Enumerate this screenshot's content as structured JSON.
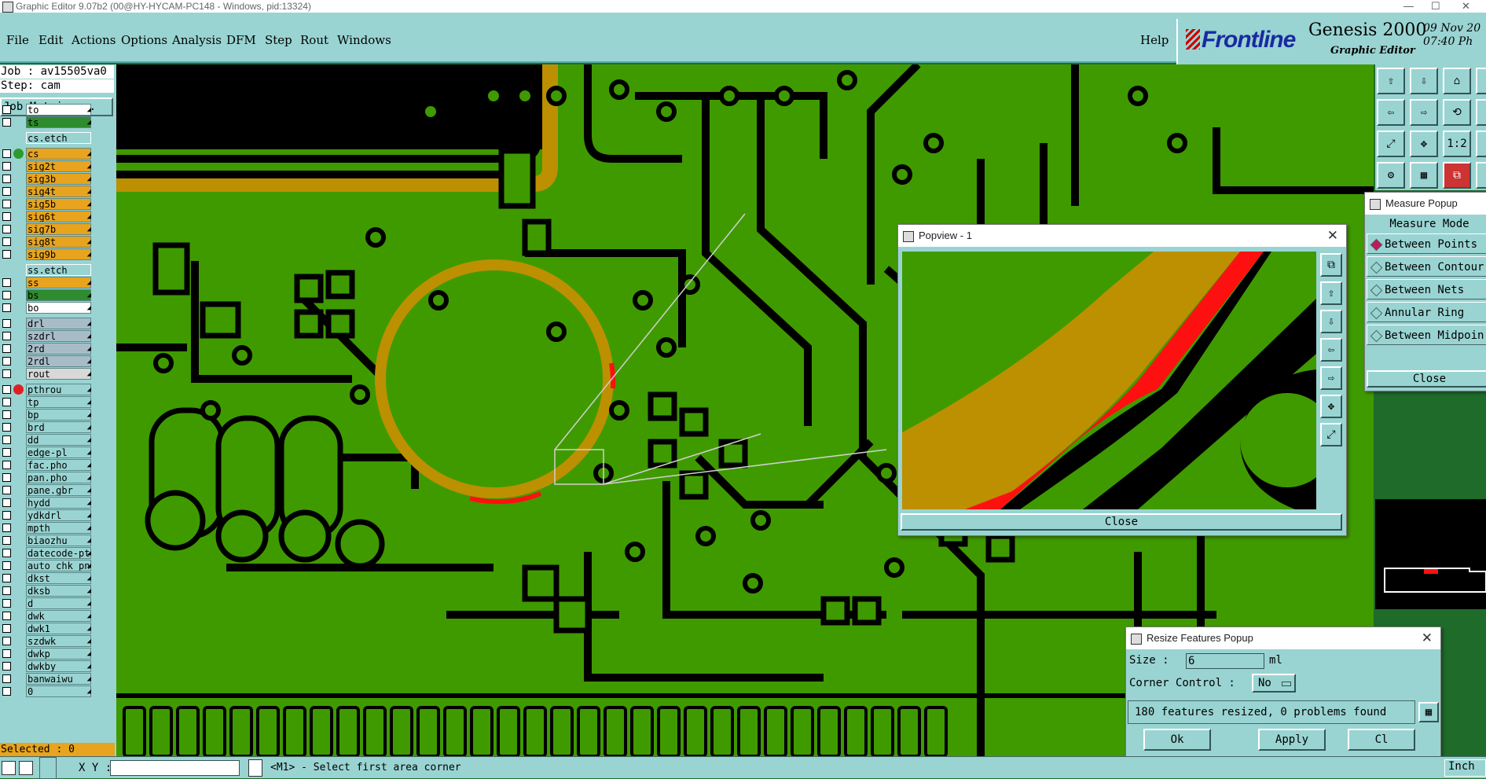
{
  "titlebar": {
    "title": "Graphic Editor 9.07b2 (00@HY-HYCAM-PC148 - Windows, pid:13324)",
    "minimize": "—",
    "maximize": "☐",
    "close": "✕"
  },
  "menu": {
    "items": [
      "File",
      "Edit",
      "Actions",
      "Options",
      "Analysis",
      "DFM",
      "Step",
      "Rout",
      "Windows"
    ],
    "help": "Help"
  },
  "brand": {
    "logo": "Frontline",
    "product": "Genesis 2000",
    "subtitle": "Graphic Editor",
    "date": "09 Nov 20",
    "time": "07:40 Ph"
  },
  "job": {
    "job_line": "Job : av15505va0",
    "step_line": "Step: cam",
    "matrix_button": "Job Matrix ..."
  },
  "layers": [
    {
      "name": "to",
      "color": "#ffffff",
      "ind": ""
    },
    {
      "name": "ts",
      "color": "#2e8b2e",
      "ind": ""
    },
    {
      "name": "cs.etch",
      "color": "#99d4d2",
      "ind": "",
      "header": true
    },
    {
      "name": "cs",
      "color": "#e8a41e",
      "ind": "#2e9b2e"
    },
    {
      "name": "sig2t",
      "color": "#e8a41e",
      "ind": ""
    },
    {
      "name": "sig3b",
      "color": "#e8a41e",
      "ind": ""
    },
    {
      "name": "sig4t",
      "color": "#e8a41e",
      "ind": ""
    },
    {
      "name": "sig5b",
      "color": "#e8a41e",
      "ind": ""
    },
    {
      "name": "sig6t",
      "color": "#e8a41e",
      "ind": ""
    },
    {
      "name": "sig7b",
      "color": "#e8a41e",
      "ind": ""
    },
    {
      "name": "sig8t",
      "color": "#e8a41e",
      "ind": ""
    },
    {
      "name": "sig9b",
      "color": "#e8a41e",
      "ind": ""
    },
    {
      "name": "ss.etch",
      "color": "#99d4d2",
      "ind": "",
      "header": true
    },
    {
      "name": "ss",
      "color": "#e8a41e",
      "ind": ""
    },
    {
      "name": "bs",
      "color": "#2e8b2e",
      "ind": ""
    },
    {
      "name": "bo",
      "color": "#ffffff",
      "ind": ""
    },
    {
      "name": "drl",
      "color": "#a8bcc8",
      "ind": ""
    },
    {
      "name": "szdrl",
      "color": "#a8bcc8",
      "ind": ""
    },
    {
      "name": "2rd",
      "color": "#a8bcc8",
      "ind": ""
    },
    {
      "name": "2rdl",
      "color": "#a8bcc8",
      "ind": ""
    },
    {
      "name": "rout",
      "color": "#d8d8d8",
      "ind": ""
    },
    {
      "name": "pthrou",
      "color": "#99d4d2",
      "ind": "#e02020"
    },
    {
      "name": "tp",
      "color": "#99d4d2",
      "ind": ""
    },
    {
      "name": "bp",
      "color": "#99d4d2",
      "ind": ""
    },
    {
      "name": "brd",
      "color": "#99d4d2",
      "ind": ""
    },
    {
      "name": "dd",
      "color": "#99d4d2",
      "ind": ""
    },
    {
      "name": "edge-pl",
      "color": "#99d4d2",
      "ind": ""
    },
    {
      "name": "fac.pho",
      "color": "#99d4d2",
      "ind": ""
    },
    {
      "name": "pan.pho",
      "color": "#99d4d2",
      "ind": ""
    },
    {
      "name": "pane.gbr",
      "color": "#99d4d2",
      "ind": ""
    },
    {
      "name": "hydd",
      "color": "#99d4d2",
      "ind": ""
    },
    {
      "name": "ydkdrl",
      "color": "#99d4d2",
      "ind": ""
    },
    {
      "name": "mpth",
      "color": "#99d4d2",
      "ind": ""
    },
    {
      "name": "biaozhu",
      "color": "#99d4d2",
      "ind": ""
    },
    {
      "name": "datecode-pt",
      "color": "#99d4d2",
      "ind": ""
    },
    {
      "name": "auto_chk_pn",
      "color": "#99d4d2",
      "ind": ""
    },
    {
      "name": "dkst",
      "color": "#99d4d2",
      "ind": ""
    },
    {
      "name": "dksb",
      "color": "#99d4d2",
      "ind": ""
    },
    {
      "name": "d",
      "color": "#99d4d2",
      "ind": ""
    },
    {
      "name": "dwk",
      "color": "#99d4d2",
      "ind": ""
    },
    {
      "name": "dwk1",
      "color": "#99d4d2",
      "ind": ""
    },
    {
      "name": "szdwk",
      "color": "#99d4d2",
      "ind": ""
    },
    {
      "name": "dwkp",
      "color": "#99d4d2",
      "ind": ""
    },
    {
      "name": "dwkby",
      "color": "#99d4d2",
      "ind": ""
    },
    {
      "name": "banwaiwu",
      "color": "#99d4d2",
      "ind": ""
    },
    {
      "name": "0",
      "color": "#99d4d2",
      "ind": ""
    }
  ],
  "selected": "Selected : 0",
  "popview": {
    "title": "Popview - 1",
    "close_label": "Close"
  },
  "measure": {
    "title": "Measure Popup",
    "mode_label": "Measure Mode",
    "options": [
      "Between Points",
      "Between Contour",
      "Between Nets",
      "Annular Ring",
      "Between Midpoin"
    ],
    "selected_index": 0,
    "close_label": "Close"
  },
  "resize": {
    "title": "Resize Features Popup",
    "size_label": "Size  :",
    "size_value": "6",
    "size_unit": "ml",
    "corner_label": "Corner Control :",
    "corner_value": "No",
    "status": "180 features resized, 0 problems found",
    "ok_label": "Ok",
    "apply_label": "Apply",
    "close_label": "Cl"
  },
  "statusbar": {
    "xy_label": "X Y :",
    "prompt": "<M1> - Select first area corner",
    "units": "Inch"
  },
  "colors": {
    "panel": "#99d4d2",
    "board": "#3f9a00",
    "copper": "#bc9000",
    "highlight": "#ff1010"
  }
}
